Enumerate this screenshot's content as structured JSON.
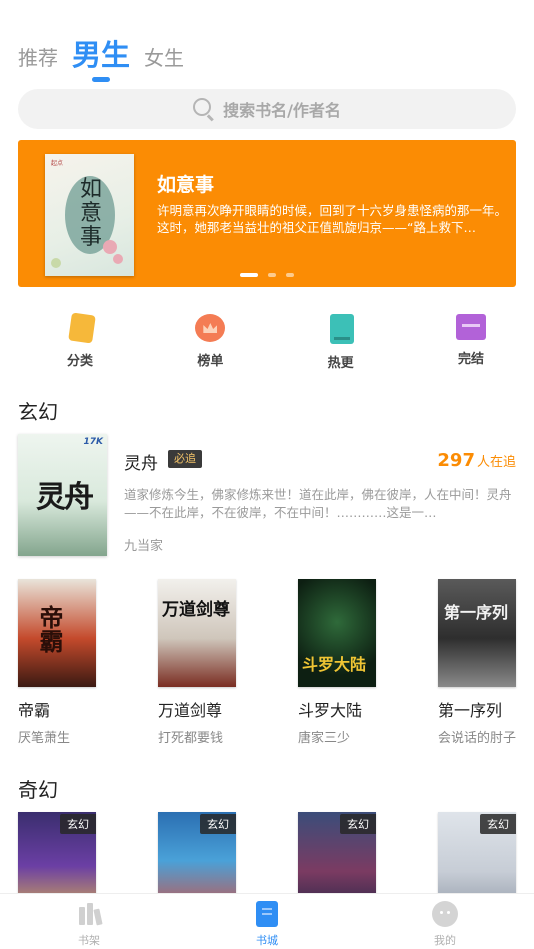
{
  "top_tabs": [
    {
      "label": "推荐",
      "active": false
    },
    {
      "label": "男生",
      "active": true
    },
    {
      "label": "女生",
      "active": false
    }
  ],
  "search": {
    "placeholder": "搜索书名/作者名"
  },
  "banner": {
    "title": "如意事",
    "description": "许明意再次睁开眼睛的时候，回到了十六岁身患怪病的那一年。这时，她那老当益壮的祖父正值凯旋归京——“路上救下…",
    "cover_text": "如意事",
    "slide_count": 3,
    "active_slide": 0
  },
  "categories": [
    {
      "label": "分类",
      "icon": "category-icon"
    },
    {
      "label": "榜单",
      "icon": "ranking-icon"
    },
    {
      "label": "热更",
      "icon": "hot-update-icon"
    },
    {
      "label": "完结",
      "icon": "completed-icon"
    }
  ],
  "sections": [
    {
      "title": "玄幻",
      "featured": {
        "name": "灵舟",
        "badge": "必追",
        "count": "297",
        "count_unit": "人在追",
        "description": "道家修炼今生，佛家修炼来世！道在此岸，佛在彼岸，人在中间！灵舟——不在此岸，不在彼岸，不在中间！…………这是一…",
        "author": "九当家",
        "cover_text": "灵舟",
        "cover_logo": "17K"
      },
      "books": [
        {
          "title": "帝霸",
          "author": "厌笔萧生",
          "cover_text": "帝霸"
        },
        {
          "title": "万道剑尊",
          "author": "打死都要钱",
          "cover_text": "万道剑尊"
        },
        {
          "title": "斗罗大陆",
          "author": "唐家三少",
          "cover_text": "斗罗大陆"
        },
        {
          "title": "第一序列",
          "author": "会说话的肘子",
          "cover_text": "第一序列"
        }
      ]
    },
    {
      "title": "奇幻",
      "books": [
        {
          "genre": "玄幻"
        },
        {
          "genre": "玄幻"
        },
        {
          "genre": "玄幻"
        },
        {
          "genre": "玄幻"
        }
      ]
    }
  ],
  "bottom_nav": [
    {
      "label": "书架",
      "icon": "bookshelf-icon",
      "active": false
    },
    {
      "label": "书城",
      "icon": "bookstore-icon",
      "active": true
    },
    {
      "label": "我的",
      "icon": "profile-icon",
      "active": false
    }
  ],
  "colors": {
    "accent": "#2f8ef4",
    "banner_bg": "#fb8c04",
    "count_color": "#fb8c04"
  }
}
